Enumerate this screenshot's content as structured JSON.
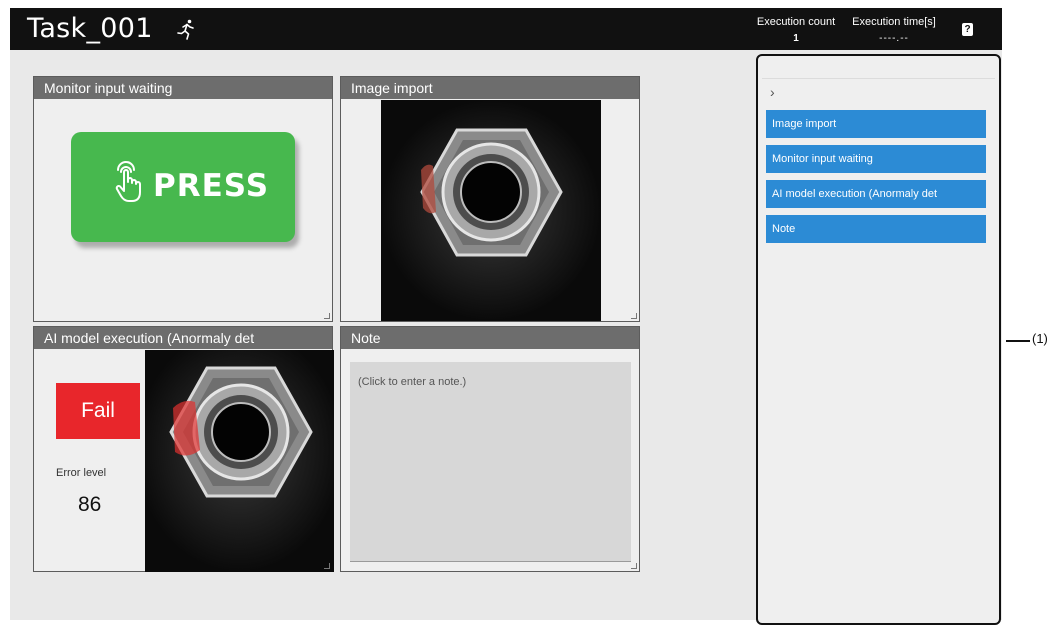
{
  "header": {
    "title": "Task_001",
    "execution_count_label": "Execution count",
    "execution_count_value": "1",
    "execution_time_label": "Execution time[s]",
    "execution_time_value": "----.--",
    "help_glyph": "?"
  },
  "panels": {
    "monitor": {
      "title": "Monitor input waiting",
      "button_label": "PRESS"
    },
    "image_import": {
      "title": "Image import"
    },
    "ai_model": {
      "title": "AI model execution (Anormaly det",
      "result": "Fail",
      "error_label": "Error level",
      "error_value": "86"
    },
    "note": {
      "title": "Note",
      "placeholder": "(Click to enter a note.)"
    }
  },
  "sidebar": {
    "chevron": "›",
    "items": [
      {
        "label": "Image import"
      },
      {
        "label": "Monitor input waiting"
      },
      {
        "label": "AI model execution (Anormaly det"
      },
      {
        "label": "Note"
      }
    ]
  },
  "callout": {
    "label": "(1)"
  },
  "colors": {
    "header_bg": "#111111",
    "panel_header": "#6d6d6d",
    "press_green": "#47b84e",
    "fail_red": "#e8262b",
    "sidebar_item_blue": "#2c8bd5"
  },
  "icons": [
    "running-person-icon",
    "help-icon",
    "pointing-hand-icon",
    "chevron-right-icon",
    "resize-handle-icon"
  ]
}
